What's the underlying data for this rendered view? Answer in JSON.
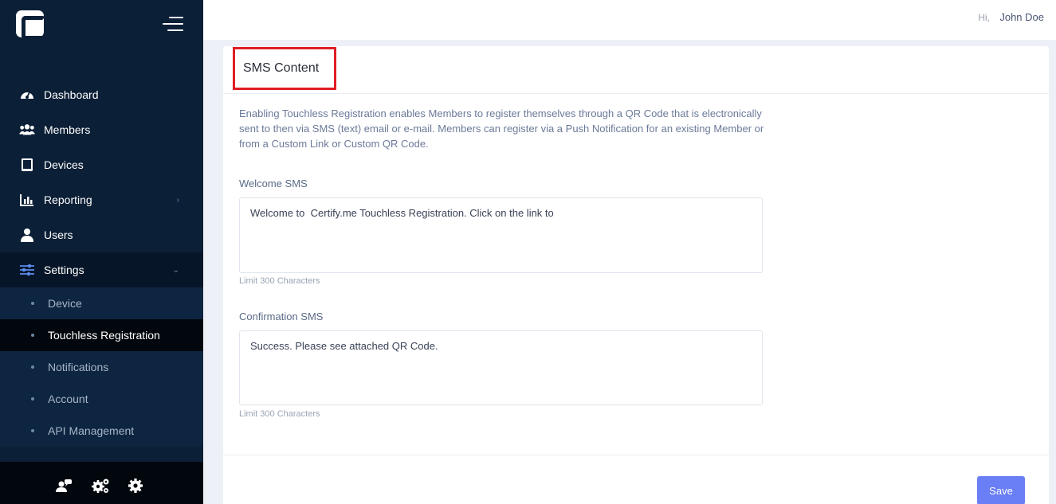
{
  "topbar": {
    "greeting": "Hi,",
    "user_name": "John Doe"
  },
  "sidebar": {
    "items": [
      {
        "label": "Dashboard",
        "icon": "dashboard-icon"
      },
      {
        "label": "Members",
        "icon": "members-icon"
      },
      {
        "label": "Devices",
        "icon": "tablet-icon"
      },
      {
        "label": "Reporting",
        "icon": "bar-chart-icon"
      },
      {
        "label": "Users",
        "icon": "user-icon"
      },
      {
        "label": "Settings",
        "icon": "sliders-icon"
      }
    ],
    "settings_sub": [
      {
        "label": "Device"
      },
      {
        "label": "Touchless Registration"
      },
      {
        "label": "Notifications"
      },
      {
        "label": "Account"
      },
      {
        "label": "API Management"
      }
    ]
  },
  "card": {
    "title": "SMS Content",
    "description": "Enabling Touchless Registration enables Members to register themselves through a QR Code that is electronically sent to then via SMS (text) email or e-mail. Members can register via a Push Notification for an existing Member or from a Custom Link or Custom QR Code.",
    "welcome": {
      "label": "Welcome SMS",
      "value": "Welcome to  Certify.me Touchless Registration. Click on the link to",
      "hint": "Limit 300 Characters"
    },
    "confirmation": {
      "label": "Confirmation SMS",
      "value": "Success. Please see attached QR Code.",
      "hint": "Limit 300 Characters"
    },
    "save_label": "Save"
  },
  "colors": {
    "sidebar_bg": "#0b1f36",
    "accent": "#6a7ef5",
    "highlight_border": "#e01e25"
  }
}
